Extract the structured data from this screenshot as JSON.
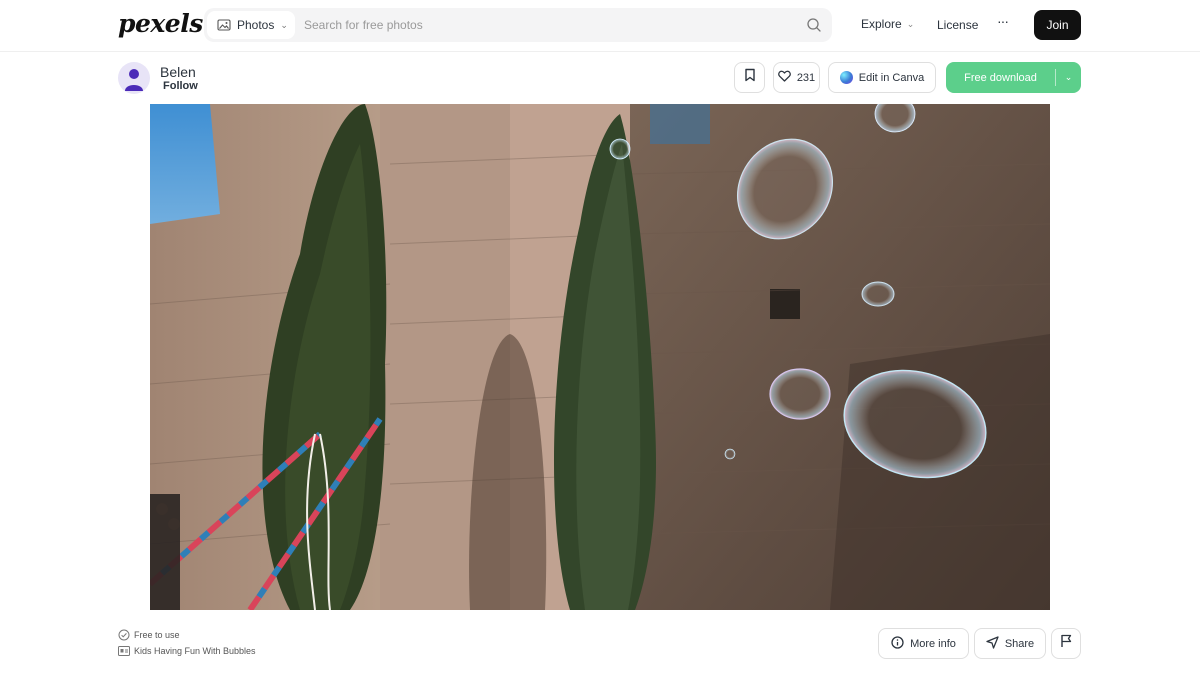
{
  "header": {
    "logo": "pexels",
    "search_type": "Photos",
    "search_placeholder": "Search for free photos",
    "explore_label": "Explore",
    "license_label": "License",
    "more_label": "···",
    "join_label": "Join"
  },
  "author": {
    "name": "Belen",
    "follow_label": "Follow"
  },
  "actions": {
    "like_count": "231",
    "canva_label": "Edit in Canva",
    "download_label": "Free download"
  },
  "info": {
    "license_note": "Free to use",
    "title": "Kids Having Fun With Bubbles",
    "more_info_label": "More info",
    "share_label": "Share"
  },
  "colors": {
    "accent_green": "#5ccf8b",
    "join_bg": "#111111"
  },
  "icons": {
    "search_type": "image-icon",
    "search": "search-icon",
    "bookmark": "bookmark-icon",
    "like": "heart-icon",
    "canva": "canva-logo-icon",
    "license": "check-circle-icon",
    "title": "caption-icon",
    "more_info": "info-icon",
    "share": "send-icon",
    "report": "flag-icon"
  }
}
